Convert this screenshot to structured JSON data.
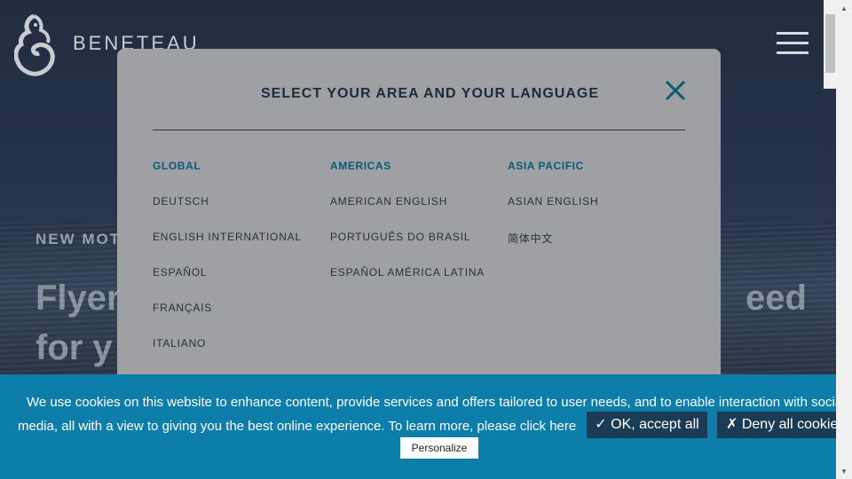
{
  "brand": {
    "name": "BENETEAU"
  },
  "hero": {
    "tag": "NEW MOT",
    "title_line1": "Flyer",
    "title_line2": "for y",
    "title_right": "eed"
  },
  "modal": {
    "title": "SELECT YOUR AREA AND YOUR LANGUAGE",
    "columns": [
      {
        "heading": "GLOBAL",
        "items": [
          "DEUTSCH",
          "ENGLISH INTERNATIONAL",
          "ESPAÑOL",
          "FRANÇAIS",
          "ITALIANO"
        ]
      },
      {
        "heading": "AMERICAS",
        "items": [
          "AMERICAN ENGLISH",
          "PORTUGUÊS DO BRASIL",
          "ESPAÑOL AMÉRICA LATINA"
        ]
      },
      {
        "heading": "ASIA PACIFIC",
        "items": [
          "ASIAN ENGLISH",
          "简体中文"
        ]
      }
    ]
  },
  "cookie": {
    "line1": "We use cookies on this website to enhance content, provide services and offers tailored to user needs, and to enable interaction with social",
    "line2": "media, all with a view to giving you the best online experience. To learn more, please click here",
    "accept_label": "✓ OK, accept all",
    "deny_label": "✗ Deny all cookies",
    "personalize_label": "Personalize"
  },
  "colors": {
    "cookie_bg": "#0d7ea9",
    "accent": "#0b5a77",
    "button_dark": "#1b3c55"
  }
}
